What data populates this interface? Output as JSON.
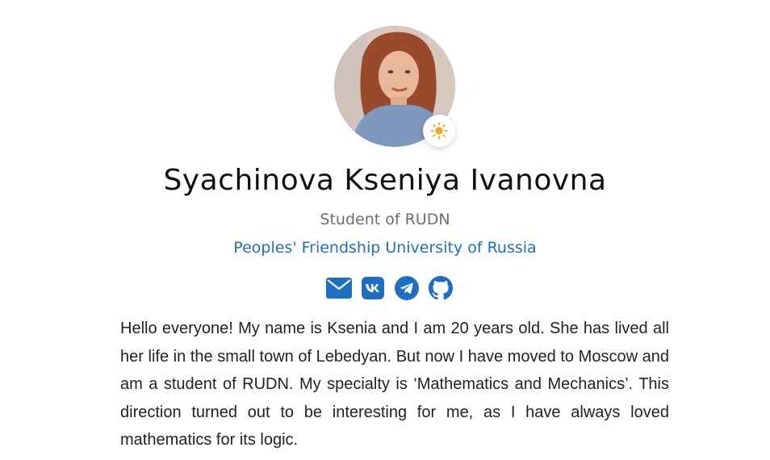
{
  "profile": {
    "name": "Syachinova Kseniya Ivanovna",
    "subtitle": "Student of RUDN",
    "university": "Peoples' Friendship University of Russia",
    "bio": "Hello everyone! My name is Ksenia and I am 20 years old. She has lived all her life in the small town of Lebedyan. But now I have moved to Moscow and am a student of RUDN. My specialty is ‘Mathematics and Mechanics’. This direction turned out to be interesting for me, as I have always loved mathematics for its logic."
  },
  "theme_toggle": {
    "icon": "sun-icon",
    "color": "#f5a623"
  },
  "socials": [
    {
      "icon": "envelope-icon"
    },
    {
      "icon": "vk-icon"
    },
    {
      "icon": "telegram-icon"
    },
    {
      "icon": "github-icon"
    }
  ],
  "colors": {
    "accent": "#1c6fc2",
    "subtitle": "#6e6e6e",
    "text": "#222222"
  }
}
